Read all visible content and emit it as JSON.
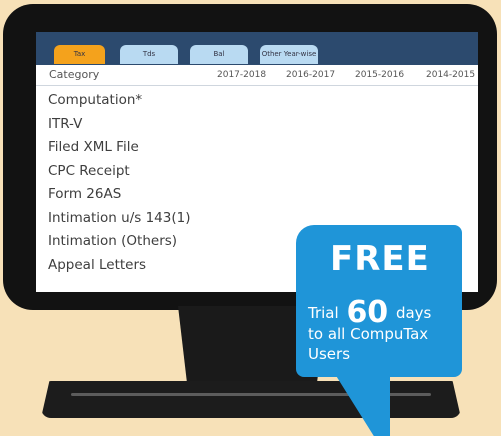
{
  "tabs": [
    "Tax",
    "Tds",
    "Bal",
    "Other Year-wise"
  ],
  "table": {
    "category_label": "Category",
    "years": [
      "2017-2018",
      "2016-2017",
      "2015-2016",
      "2014-2015"
    ],
    "rows": [
      "Computation*",
      "ITR-V",
      "Filed XML File",
      "CPC Receipt",
      "Form 26AS",
      "Intimation u/s 143(1)",
      "Intimation (Others)",
      "Appeal Letters"
    ]
  },
  "promo": {
    "headline": "FREE",
    "trial_prefix": "Trial",
    "trial_days": "60",
    "trial_suffix": "days",
    "line2": "to all CompuTax",
    "line3": "Users"
  },
  "colors": {
    "background": "#f7e1b8",
    "monitor": "#121212",
    "tabbar": "#2c4a6e",
    "tab_active": "#f4a21c",
    "tab_inactive": "#b9daf2",
    "promo": "#1f95d8"
  }
}
